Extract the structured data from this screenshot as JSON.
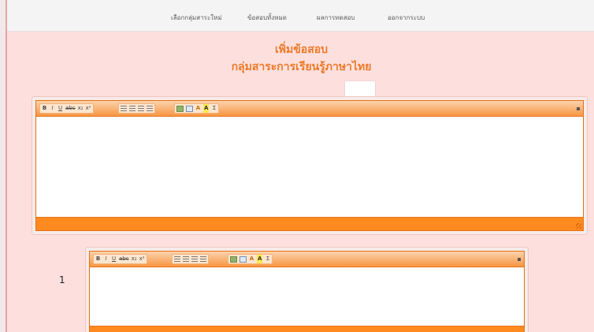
{
  "nav": {
    "items": [
      {
        "label": "เลือกกลุ่มสาระใหม่"
      },
      {
        "label": "ข้อสอบทั้งหมด"
      },
      {
        "label": "ผลการทดสอบ"
      },
      {
        "label": "ออกจากระบบ"
      }
    ]
  },
  "header": {
    "title": "เพิ่มข้อสอบ",
    "subtitle": "กลุ่มสาระการเรียนรู้ภาษาไทย"
  },
  "question": {
    "number": "1"
  },
  "toolbar": {
    "bold": "B",
    "italic": "I",
    "underline": "U",
    "strike": "abc",
    "subscript": "x₂",
    "superscript": "x²",
    "font_color": "A",
    "highlight": "A",
    "sigma": "Σ"
  },
  "colors": {
    "accent": "#ee7a28",
    "editor_frame": "#ff8a1f",
    "page_bg": "#fde0de"
  }
}
